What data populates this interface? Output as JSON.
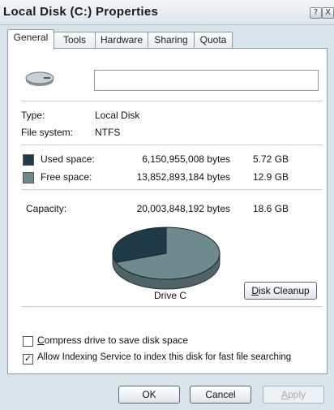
{
  "window": {
    "title": "Local Disk (C:) Properties",
    "help_button": "?",
    "close_button": "X"
  },
  "tabs": [
    {
      "label": "General",
      "active": true
    },
    {
      "label": "Tools",
      "active": false
    },
    {
      "label": "Hardware",
      "active": false
    },
    {
      "label": "Sharing",
      "active": false
    },
    {
      "label": "Quota",
      "active": false
    }
  ],
  "general": {
    "drive_name_value": "",
    "type_label": "Type:",
    "type_value": "Local Disk",
    "filesystem_label": "File system:",
    "filesystem_value": "NTFS",
    "used": {
      "label": "Used space:",
      "bytes": "6,150,955,008 bytes",
      "size": "5.72 GB",
      "color": "#1f3b47"
    },
    "free": {
      "label": "Free space:",
      "bytes": "13,852,893,184 bytes",
      "size": "12.9 GB",
      "color": "#6f8a8e"
    },
    "capacity": {
      "label": "Capacity:",
      "bytes": "20,003,848,192 bytes",
      "size": "18.6 GB"
    },
    "drive_label": "Drive C",
    "disk_cleanup_label": "Disk Cleanup",
    "compress_label": "Compress drive to save disk space",
    "compress_checked": false,
    "index_label": "Allow Indexing Service to index this disk for fast file searching",
    "index_checked": true
  },
  "footer": {
    "ok_label": "OK",
    "cancel_label": "Cancel",
    "apply_label": "Apply",
    "apply_enabled": false
  },
  "chart_data": {
    "type": "pie",
    "title": "",
    "slices": [
      {
        "name": "Used space",
        "value": 6150955008,
        "color": "#1f3b47"
      },
      {
        "name": "Free space",
        "value": 13852893184,
        "color": "#6f8a8e"
      }
    ]
  }
}
